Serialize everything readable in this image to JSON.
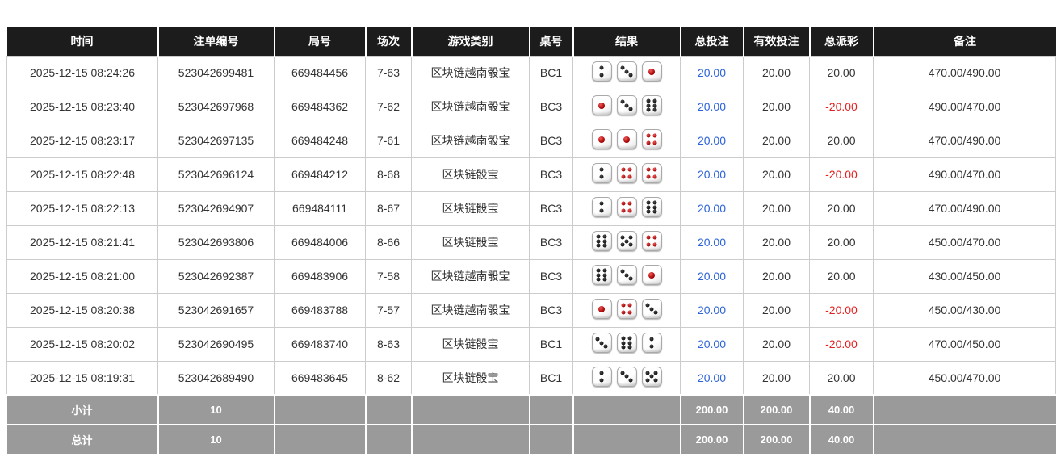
{
  "table": {
    "columns": [
      {
        "key": "time",
        "label": "时间"
      },
      {
        "key": "bet_id",
        "label": "注单编号"
      },
      {
        "key": "round_id",
        "label": "局号"
      },
      {
        "key": "session",
        "label": "场次"
      },
      {
        "key": "game_type",
        "label": "游戏类别"
      },
      {
        "key": "table_no",
        "label": "桌号"
      },
      {
        "key": "result",
        "label": "结果"
      },
      {
        "key": "total_bet",
        "label": "总投注"
      },
      {
        "key": "valid_bet",
        "label": "有效投注"
      },
      {
        "key": "total_payout",
        "label": "总派彩"
      },
      {
        "key": "remark",
        "label": "备注"
      }
    ],
    "dice_icon_names": {
      "1": "die-1-icon",
      "2": "die-2-icon",
      "3": "die-3-icon",
      "4": "die-4-icon",
      "5": "die-5-icon",
      "6": "die-6-icon"
    },
    "rows": [
      {
        "time": "2025-12-15 08:24:26",
        "bet_id": "523042699481",
        "round_id": "669484456",
        "session": "7-63",
        "game_type": "区块链越南骰宝",
        "table_no": "BC1",
        "dice": [
          2,
          3,
          1
        ],
        "total_bet": "20.00",
        "valid_bet": "20.00",
        "total_payout": "20.00",
        "payout_negative": false,
        "remark": "470.00/490.00"
      },
      {
        "time": "2025-12-15 08:23:40",
        "bet_id": "523042697968",
        "round_id": "669484362",
        "session": "7-62",
        "game_type": "区块链越南骰宝",
        "table_no": "BC3",
        "dice": [
          1,
          3,
          6
        ],
        "total_bet": "20.00",
        "valid_bet": "20.00",
        "total_payout": "-20.00",
        "payout_negative": true,
        "remark": "490.00/470.00"
      },
      {
        "time": "2025-12-15 08:23:17",
        "bet_id": "523042697135",
        "round_id": "669484248",
        "session": "7-61",
        "game_type": "区块链越南骰宝",
        "table_no": "BC3",
        "dice": [
          1,
          1,
          4
        ],
        "total_bet": "20.00",
        "valid_bet": "20.00",
        "total_payout": "20.00",
        "payout_negative": false,
        "remark": "470.00/490.00"
      },
      {
        "time": "2025-12-15 08:22:48",
        "bet_id": "523042696124",
        "round_id": "669484212",
        "session": "8-68",
        "game_type": "区块链骰宝",
        "table_no": "BC3",
        "dice": [
          2,
          4,
          4
        ],
        "total_bet": "20.00",
        "valid_bet": "20.00",
        "total_payout": "-20.00",
        "payout_negative": true,
        "remark": "490.00/470.00"
      },
      {
        "time": "2025-12-15 08:22:13",
        "bet_id": "523042694907",
        "round_id": "669484111",
        "session": "8-67",
        "game_type": "区块链骰宝",
        "table_no": "BC3",
        "dice": [
          2,
          4,
          6
        ],
        "total_bet": "20.00",
        "valid_bet": "20.00",
        "total_payout": "20.00",
        "payout_negative": false,
        "remark": "470.00/490.00"
      },
      {
        "time": "2025-12-15 08:21:41",
        "bet_id": "523042693806",
        "round_id": "669484006",
        "session": "8-66",
        "game_type": "区块链骰宝",
        "table_no": "BC3",
        "dice": [
          6,
          5,
          4
        ],
        "total_bet": "20.00",
        "valid_bet": "20.00",
        "total_payout": "20.00",
        "payout_negative": false,
        "remark": "450.00/470.00"
      },
      {
        "time": "2025-12-15 08:21:00",
        "bet_id": "523042692387",
        "round_id": "669483906",
        "session": "7-58",
        "game_type": "区块链越南骰宝",
        "table_no": "BC3",
        "dice": [
          6,
          3,
          1
        ],
        "total_bet": "20.00",
        "valid_bet": "20.00",
        "total_payout": "20.00",
        "payout_negative": false,
        "remark": "430.00/450.00"
      },
      {
        "time": "2025-12-15 08:20:38",
        "bet_id": "523042691657",
        "round_id": "669483788",
        "session": "7-57",
        "game_type": "区块链越南骰宝",
        "table_no": "BC3",
        "dice": [
          1,
          4,
          3
        ],
        "total_bet": "20.00",
        "valid_bet": "20.00",
        "total_payout": "-20.00",
        "payout_negative": true,
        "remark": "450.00/430.00"
      },
      {
        "time": "2025-12-15 08:20:02",
        "bet_id": "523042690495",
        "round_id": "669483740",
        "session": "8-63",
        "game_type": "区块链骰宝",
        "table_no": "BC1",
        "dice": [
          3,
          6,
          2
        ],
        "total_bet": "20.00",
        "valid_bet": "20.00",
        "total_payout": "-20.00",
        "payout_negative": true,
        "remark": "470.00/450.00"
      },
      {
        "time": "2025-12-15 08:19:31",
        "bet_id": "523042689490",
        "round_id": "669483645",
        "session": "8-62",
        "game_type": "区块链骰宝",
        "table_no": "BC1",
        "dice": [
          2,
          3,
          5
        ],
        "total_bet": "20.00",
        "valid_bet": "20.00",
        "total_payout": "20.00",
        "payout_negative": false,
        "remark": "450.00/470.00"
      }
    ],
    "footers": [
      {
        "key": "subtotal",
        "label": "小计",
        "count": "10",
        "total_bet": "200.00",
        "valid_bet": "200.00",
        "total_payout": "40.00"
      },
      {
        "key": "total",
        "label": "总计",
        "count": "10",
        "total_bet": "200.00",
        "valid_bet": "200.00",
        "total_payout": "40.00"
      }
    ]
  },
  "colors": {
    "header_bg": "#1c1c1c",
    "footer_bg": "#9a9a9a",
    "bet_amount_blue": "#2e64d9",
    "negative_red": "#e22121",
    "dice_dot_black": "#111111",
    "dice_dot_red": "#a00000",
    "border_gray": "#cccccc"
  }
}
